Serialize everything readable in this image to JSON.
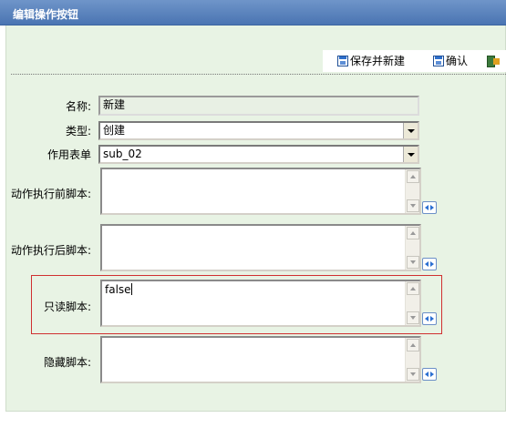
{
  "window": {
    "title": "编辑操作按钮",
    "accent_color": "#4a74b2",
    "panel_color": "#e8f3e4",
    "highlight_color": "#d03030"
  },
  "toolbar": {
    "save_new_label": "保存并新建",
    "confirm_label": "确认",
    "save_new_icon": "save-icon",
    "confirm_icon": "save-icon",
    "exit_icon": "exit-icon"
  },
  "form": {
    "name": {
      "label": "名称:",
      "value": "新建"
    },
    "type": {
      "label": "类型:",
      "value": "创建"
    },
    "action_form": {
      "label": "作用表单",
      "value": "sub_02"
    },
    "pre_script": {
      "label": "动作执行前脚本:",
      "value": ""
    },
    "post_script": {
      "label": "动作执行后脚本:",
      "value": ""
    },
    "readonly_script": {
      "label": "只读脚本:",
      "value": "false"
    },
    "hidden_script": {
      "label": "隐藏脚本:",
      "value": ""
    }
  }
}
